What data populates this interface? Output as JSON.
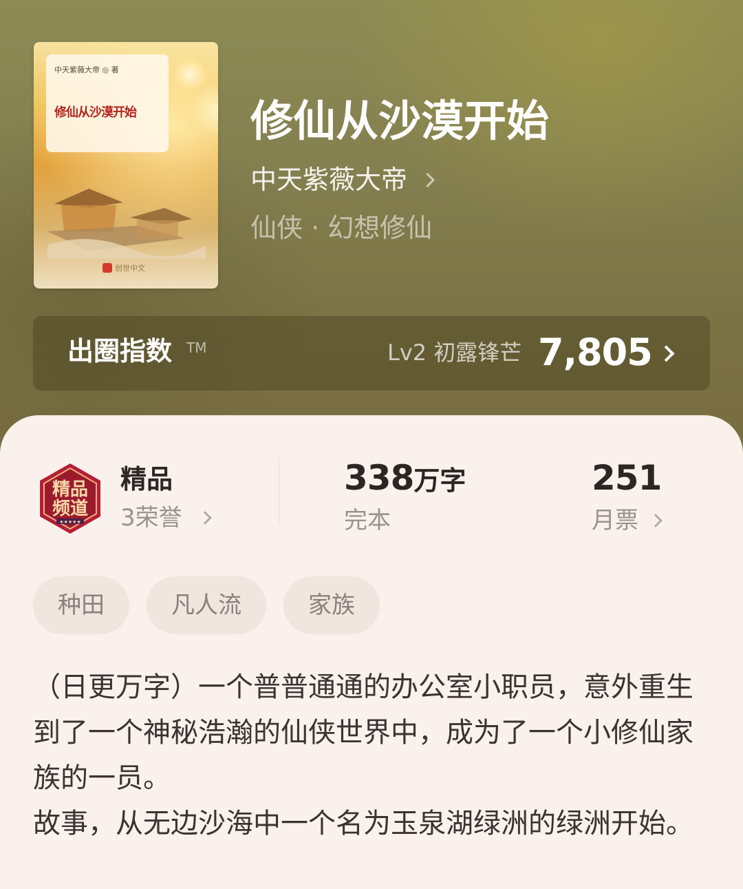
{
  "book": {
    "title": "修仙从沙漠开始",
    "author": "中天紫薇大帝",
    "genre": "仙侠 · 幻想修仙",
    "cover": {
      "author_line": "中天紫薇大帝 ◎ 著",
      "title": "修仙从沙漠开始",
      "publisher": "创世中文"
    }
  },
  "index_bar": {
    "name": "出圈指数",
    "tm": "TM",
    "level": "Lv2 初露锋芒",
    "value": "7,805"
  },
  "stats": {
    "honor_title": "精品",
    "honor_sub": "3荣誉",
    "words_num": "338",
    "words_unit": "万字",
    "status": "完本",
    "tickets": "251",
    "tickets_label": "月票"
  },
  "tags": [
    "种田",
    "凡人流",
    "家族"
  ],
  "description": {
    "line1": "（日更万字）一个普普通通的办公室小职员，意外重生到了一个神秘浩瀚的仙侠世界中，成为了一个小修仙家族的一员。",
    "line2": "故事，从无边沙海中一个名为玉泉湖绿洲的绿洲开始。"
  },
  "badge_icon": "premium-channel-badge-icon",
  "colors": {
    "header_bg": "#848050",
    "card_bg": "#faf1ec",
    "tag_bg": "#f0e5df",
    "badge_red": "#b51f36"
  }
}
